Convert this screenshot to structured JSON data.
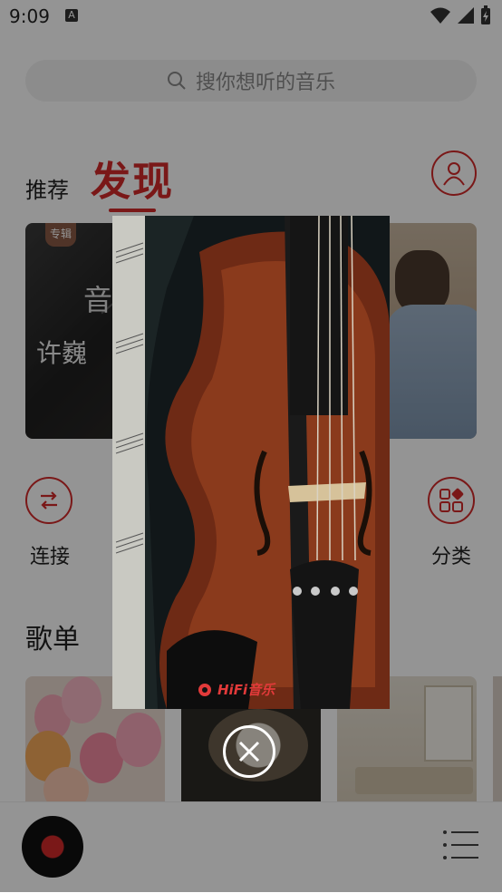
{
  "status_bar": {
    "time": "9:09",
    "a_badge": "A"
  },
  "search": {
    "placeholder": "搜你想听的音乐"
  },
  "tabs": {
    "recommend": "推荐",
    "discover": "发现"
  },
  "banner": {
    "tag": "专辑",
    "left_title": "许巍",
    "left_big": "音"
  },
  "quick_actions": {
    "left_label": "连接",
    "right_label": "分类"
  },
  "playlists": {
    "title": "歌单"
  },
  "popup": {
    "brand": "HiFi音乐"
  },
  "colors": {
    "accent": "#d22a2a"
  },
  "icons": [
    "search-icon",
    "user-icon",
    "connect-icon",
    "category-icon",
    "vinyl-disc-icon",
    "playlist-menu-icon",
    "close-icon",
    "wifi-icon",
    "signal-icon",
    "battery-icon"
  ]
}
